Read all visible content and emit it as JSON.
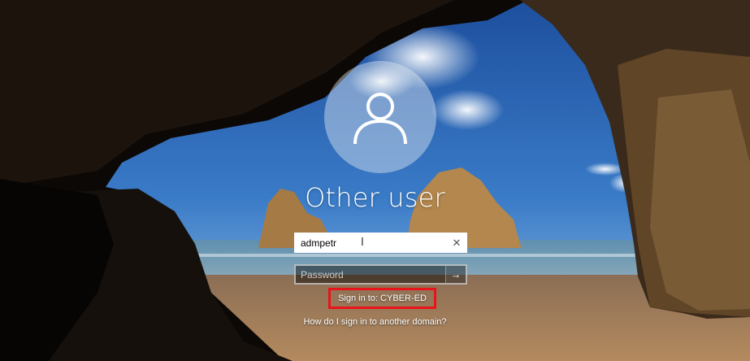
{
  "lockscreen": {
    "user_icon": "user-silhouette-icon",
    "username": "Other user",
    "username_field": {
      "value": "admpetr",
      "clear_icon": "close-icon",
      "clear_glyph": "✕"
    },
    "password_field": {
      "placeholder": "Password",
      "submit_icon": "arrow-right-icon",
      "submit_glyph": "→"
    },
    "sign_in_to": "Sign in to: CYBER-ED",
    "domain_link": "How do I sign in to another domain?",
    "colors": {
      "highlight_border": "#e8141b",
      "text": "#ffffff"
    }
  }
}
